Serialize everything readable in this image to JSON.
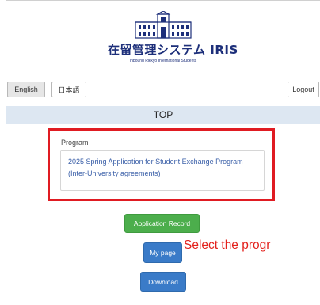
{
  "logo": {
    "title": "在留管理システム IRIS",
    "subtitle": "Inbound Rikkyo International Students",
    "icon": "building-icon"
  },
  "header": {
    "english_label": "English",
    "japanese_label": "日本語",
    "logout_label": "Logout"
  },
  "page_title": "TOP",
  "program": {
    "label": "Program",
    "name": "2025 Spring Application for Student Exchange Program (Inter-University agreements)"
  },
  "actions": {
    "application_record": "Application Record",
    "my_page": "My page",
    "download": "Download"
  },
  "annotation": "Select the progr",
  "colors": {
    "highlight": "#e01b22",
    "green": "#4cae4c",
    "blue": "#3a7bc8",
    "topbar": "#dde7f2"
  }
}
